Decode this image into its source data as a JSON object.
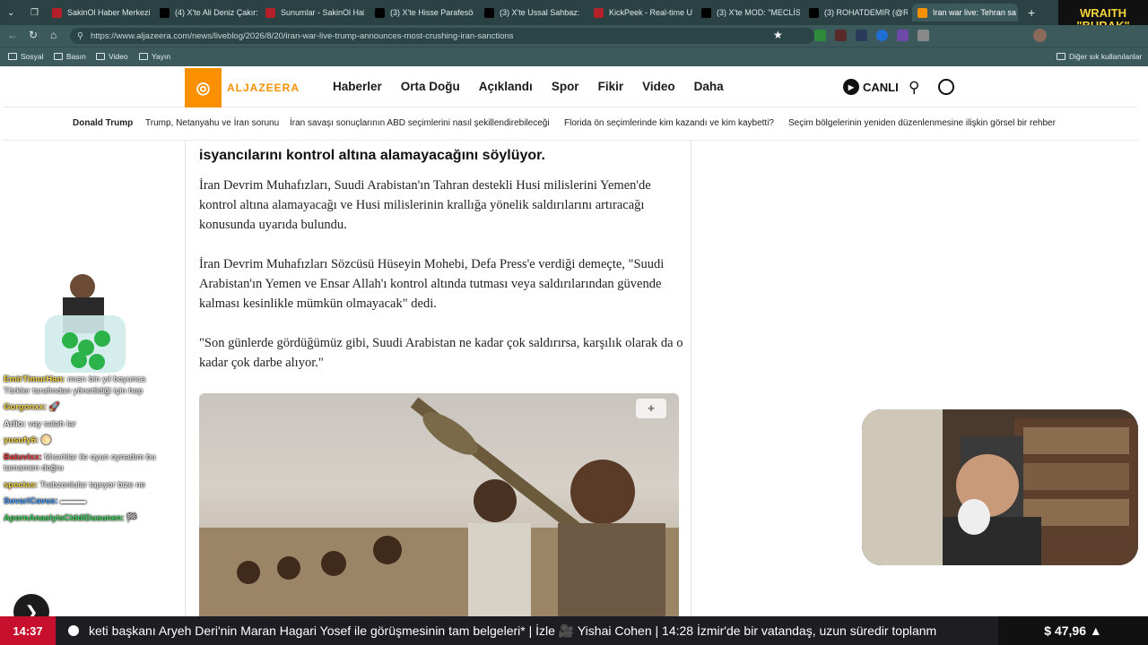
{
  "tabs": [
    {
      "title": "SakinOl Haber Merkezi",
      "fav_color": "#b3202a"
    },
    {
      "title": "(4) X'te Ali Deniz Çakır:",
      "fav_color": "#000000"
    },
    {
      "title": "Sunumlar - SakinOl Hab",
      "fav_color": "#b3202a"
    },
    {
      "title": "(3) X'te Hisse Parafesör",
      "fav_color": "#000000"
    },
    {
      "title": "(3) X'te Ussal Sahbaz:",
      "fav_color": "#000000"
    },
    {
      "title": "KickPeek - Real-time UI",
      "fav_color": "#b3202a"
    },
    {
      "title": "(3) X'te MOD: \"MECLİS",
      "fav_color": "#000000"
    },
    {
      "title": "(3) ROHATDEMIR (@RO",
      "fav_color": "#000000"
    },
    {
      "title": "Iran war live: Tehran sa",
      "fav_color": "#fa9000"
    }
  ],
  "url": "https://www.aljazeera.com/news/liveblog/2026/8/20/iran-war-live-trump-announces-most-crushing-iran-sanctions",
  "bookmarks": [
    "Sosyal",
    "Basın",
    "Video",
    "Yayın"
  ],
  "other_bookmarks": "Diğer sık kullanılanlar",
  "site": {
    "logo_text": "ALJAZEERA",
    "nav": [
      "Haberler",
      "Orta Doğu",
      "Açıklandı",
      "Spor",
      "Fikir",
      "Video",
      "Daha"
    ],
    "live_label": "CANLI",
    "subnav": [
      "Donald Trump",
      "Trump, Netanyahu ve İran sorunu",
      "İran savaşı sonuçlarının ABD seçimlerini nasıl şekillendirebileceği",
      "Florida ön seçimlerinde kim kazandı ve kim kaybetti?",
      "Seçim bölgelerinin yeniden düzenlenmesine ilişkin görsel bir rehber"
    ]
  },
  "article": {
    "headline": "isyancılarını kontrol altına alamayacağını söylüyor.",
    "paragraphs": [
      "İran Devrim Muhafızları, Suudi Arabistan'ın Tahran destekli Husi milislerini Yemen'de kontrol altına alamayacağı ve Husi milislerinin krallığa yönelik saldırılarını artıracağı konusunda uyarıda bulundu.",
      "İran Devrim Muhafızları Sözcüsü Hüseyin Mohebi, Defa Press'e verdiği demeçte, \"Suudi Arabistan'ın Yemen ve Ensar Allah'ı kontrol altında tutması veya saldırılarından güvende kalması kesinlikle mümkün olmayacak\" dedi.",
      "\"Son günlerde gördüğümüz gibi, Suudi Arabistan ne kadar çok saldırırsa, karşılık olarak da o kadar çok darbe alıyor.\""
    ]
  },
  "chat": [
    {
      "user": "EmirTimurHan:",
      "text": "mısrı bin yıl boyunca Türkler tarafından yönetildiği için hep",
      "color": "#f6d743"
    },
    {
      "user": "Gorgonxx:",
      "text": "🚀",
      "color": "#f6d743"
    },
    {
      "user": "Arlio:",
      "text": "vay salah lar",
      "color": "#f0f0f0"
    },
    {
      "user": "yusufy6:",
      "text": "🌕",
      "color": "#f6d743"
    },
    {
      "user": "Batuvixx:",
      "text": "Mısırlılar ile oyun oynadım bu tamamen doğru",
      "color": "#e63b3b"
    },
    {
      "user": "specias:",
      "text": "Trabzonlular tapıyor bize ne",
      "color": "#f6d743"
    },
    {
      "user": "SuvariCavus:",
      "text": "▬▬▬",
      "color": "#4fa3ff"
    },
    {
      "user": "ApornAnaslyisCiddiDusunen:",
      "text": "🏁",
      "color": "#3fd45b"
    }
  ],
  "stream_badge": {
    "line1": "WRAITH",
    "line2": "\"BURAK\""
  },
  "ticker": {
    "clock": "14:37",
    "text": "keti başkanı Aryeh Deri'nin Maran Hagari Yosef ile görüşmesinin tam belgeleri* | İzle 🎥 Yishai Cohen   |   14:28  İzmir'de bir vatandaş, uzun süredir toplanm",
    "price": "$ 47,96 ▲"
  }
}
